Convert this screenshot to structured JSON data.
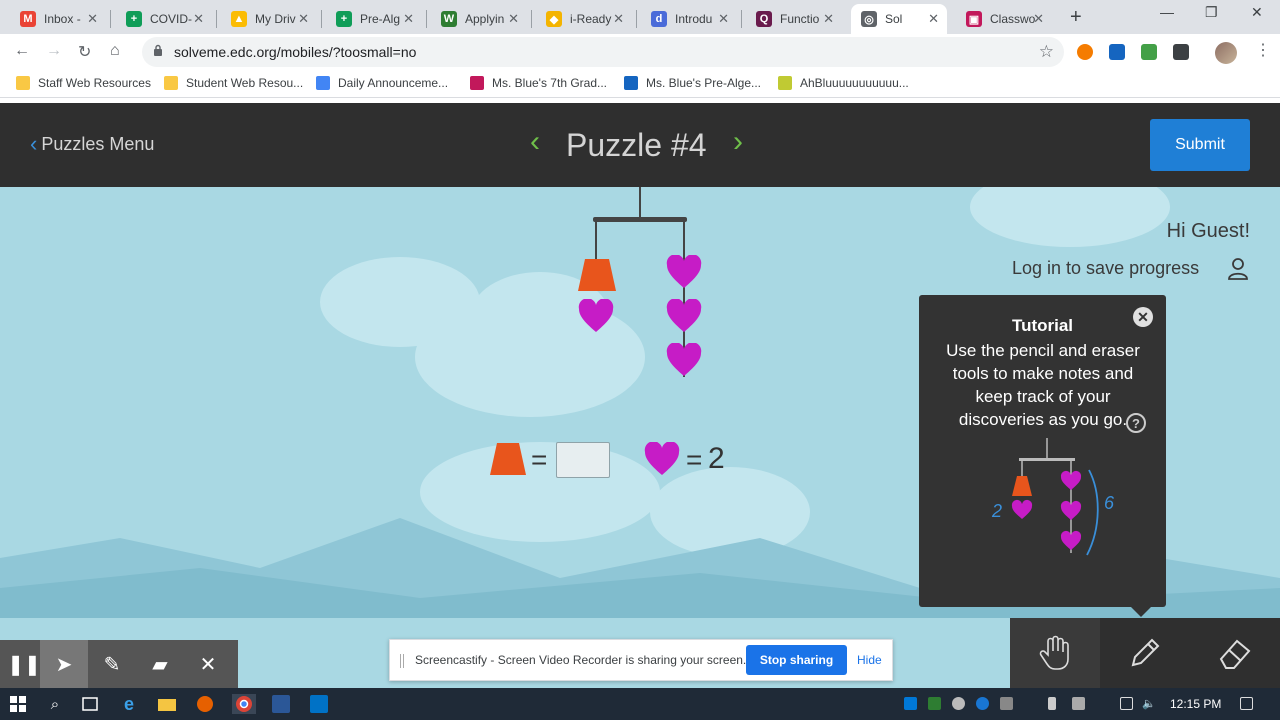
{
  "browser": {
    "tabs": [
      {
        "title": "Inbox -",
        "color": "#ea4335",
        "glyph": "M"
      },
      {
        "title": "COVID-",
        "color": "#0f9d58",
        "glyph": "+"
      },
      {
        "title": "My Driv",
        "color": "#fbbc04",
        "glyph": "▲"
      },
      {
        "title": "Pre-Alg",
        "color": "#0f9d58",
        "glyph": "+"
      },
      {
        "title": "Applyin",
        "color": "#2e7d32",
        "glyph": "W"
      },
      {
        "title": "i-Ready",
        "color": "#f4b400",
        "glyph": "◆"
      },
      {
        "title": "Introdu",
        "color": "#4a6bd9",
        "glyph": "d"
      },
      {
        "title": "Functio",
        "color": "#6a1b4d",
        "glyph": "Q"
      },
      {
        "title": "Sol",
        "color": "#5f6368",
        "glyph": "◎"
      },
      {
        "title": "Classwo",
        "color": "#c2185b",
        "glyph": "▣"
      }
    ],
    "url": "solveme.edc.org/mobiles/?toosmall=no",
    "bookmarks": [
      "Staff Web Resources",
      "Student Web Resou...",
      "Daily Announceme...",
      "Ms. Blue's 7th Grad...",
      "Ms. Blue's Pre-Alge...",
      "AhBluuuuuuuuuuu..."
    ]
  },
  "header": {
    "back_label": "Puzzles Menu",
    "title": "Puzzle #4",
    "submit_label": "Submit"
  },
  "user": {
    "greeting": "Hi Guest!",
    "login_text": "Log in to save progress"
  },
  "equation": {
    "equals": "=",
    "heart_value": "2"
  },
  "tutorial": {
    "title": "Tutorial",
    "body": "Use the pencil and eraser tools to make notes and keep track of your discoveries as you go.",
    "close_glyph": "✕",
    "help_glyph": "?",
    "note_left": "2",
    "note_right": "6"
  },
  "castify": {
    "message": "Screencastify - Screen Video Recorder is sharing your screen.",
    "stop_label": "Stop sharing",
    "hide_label": "Hide"
  },
  "taskbar": {
    "time": "12:15 PM"
  },
  "colors": {
    "accent_blue": "#1f7fd6",
    "header_bg": "#2f2f2f",
    "sky": "#a9d8e3",
    "heart": "#c61cc6",
    "trapezoid": "#e8551c",
    "nav_green": "#6fbf4a"
  }
}
